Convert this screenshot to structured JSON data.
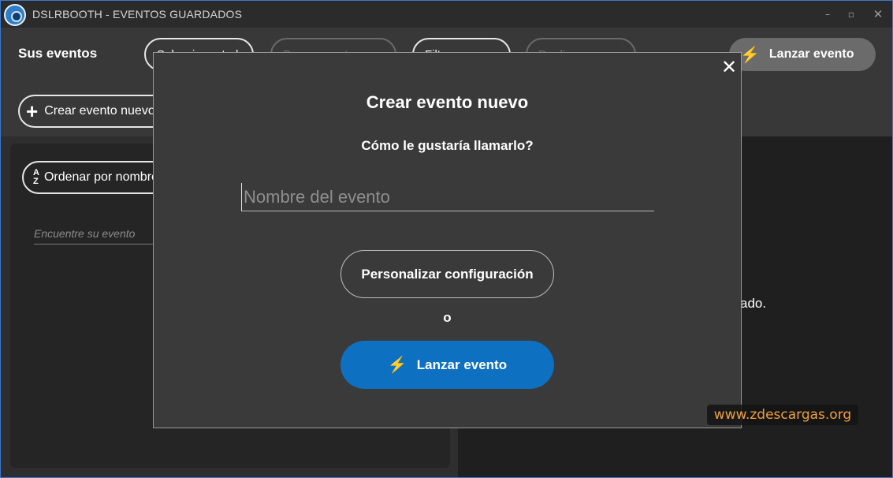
{
  "window": {
    "title": "DSLRBOOTH - EVENTOS GUARDADOS",
    "minimize": "–",
    "maximize": "▫",
    "close": "✕"
  },
  "toolbar": {
    "heading": "Sus eventos",
    "select_all_label": "Seleccionar todo",
    "delete_label": "Borrar eventos",
    "filter_label": "Filtrar",
    "duplicate_label": "Duplicar",
    "launch_label": "Lanzar evento",
    "create_label": "Crear evento nuevo"
  },
  "left_panel": {
    "sort_label": "Ordenar por nombre",
    "search_placeholder": "Encuentre su evento"
  },
  "right_panel": {
    "partial_text": "ado."
  },
  "modal": {
    "title": "Crear evento nuevo",
    "subtitle": "Cómo le gustaría llamarlo?",
    "name_placeholder": "Nombre del evento",
    "name_value": "",
    "customize_label": "Personalizar configuración",
    "or_text": "o",
    "launch_label": "Lanzar evento",
    "close_icon": "✕"
  },
  "watermark": "www.zdescargas.org",
  "colors": {
    "accent": "#0d70c1",
    "window_border": "#3c78c3",
    "watermark": "#f0a03a"
  }
}
